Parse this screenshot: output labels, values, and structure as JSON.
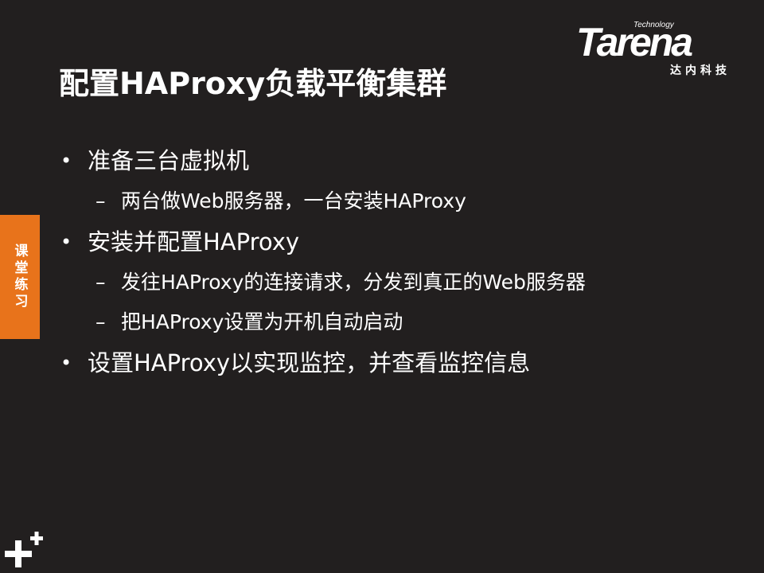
{
  "slide": {
    "title": "配置HAProxy负载平衡集群",
    "side_tab": "课堂练习",
    "bullets": [
      {
        "text": "准备三台虚拟机",
        "sub": [
          "两台做Web服务器，一台安装HAProxy"
        ]
      },
      {
        "text": "安装并配置HAProxy",
        "sub": [
          "发往HAProxy的连接请求，分发到真正的Web服务器",
          "把HAProxy设置为开机自动启动"
        ]
      },
      {
        "text": "设置HAProxy以实现监控，并查看监控信息",
        "sub": []
      }
    ],
    "bullet_mark": "•",
    "sub_mark": "–"
  },
  "logo": {
    "small": "Technology",
    "word": "Tarena",
    "cn": "达内科技"
  },
  "colors": {
    "background": "#221f1f",
    "accent": "#e8731b",
    "text": "#ffffff"
  },
  "icons": [
    "plus-icon"
  ]
}
